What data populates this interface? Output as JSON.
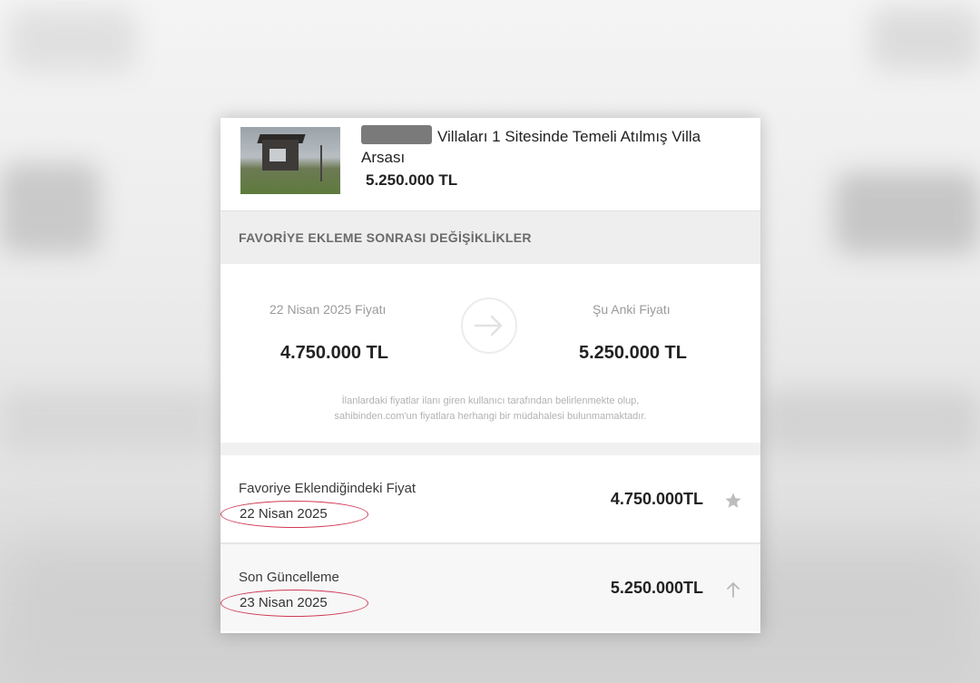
{
  "listing": {
    "title": "Villaları 1 Sitesinde Temeli Atılmış Villa Arsası",
    "price": "5.250.000 TL"
  },
  "section": {
    "title": "FAVORİYE EKLEME SONRASI DEĞİŞİKLİKLER"
  },
  "comparison": {
    "old_label": "22 Nisan 2025 Fiyatı",
    "old_price": "4.750.000 TL",
    "new_label": "Şu Anki Fiyatı",
    "new_price": "5.250.000 TL",
    "disclaimer_line1": "İlanlardaki fiyatlar ilanı giren kullanıcı tarafından belirlenmekte olup,",
    "disclaimer_line2": "sahibinden.com'un fiyatlara herhangi bir müdahalesi bulunmamaktadır."
  },
  "history": [
    {
      "label": "Favoriye Eklendiğindeki Fiyat",
      "date": "22 Nisan 2025",
      "price": "4.750.000TL",
      "icon": "star-icon"
    },
    {
      "label": "Son Güncelleme",
      "date": "23 Nisan 2025",
      "price": "5.250.000TL",
      "icon": "arrow-up-icon"
    }
  ],
  "colors": {
    "annotation_circle": "#d03a55",
    "section_header_bg": "#eeeeee",
    "muted_text": "#9a9a9a"
  }
}
